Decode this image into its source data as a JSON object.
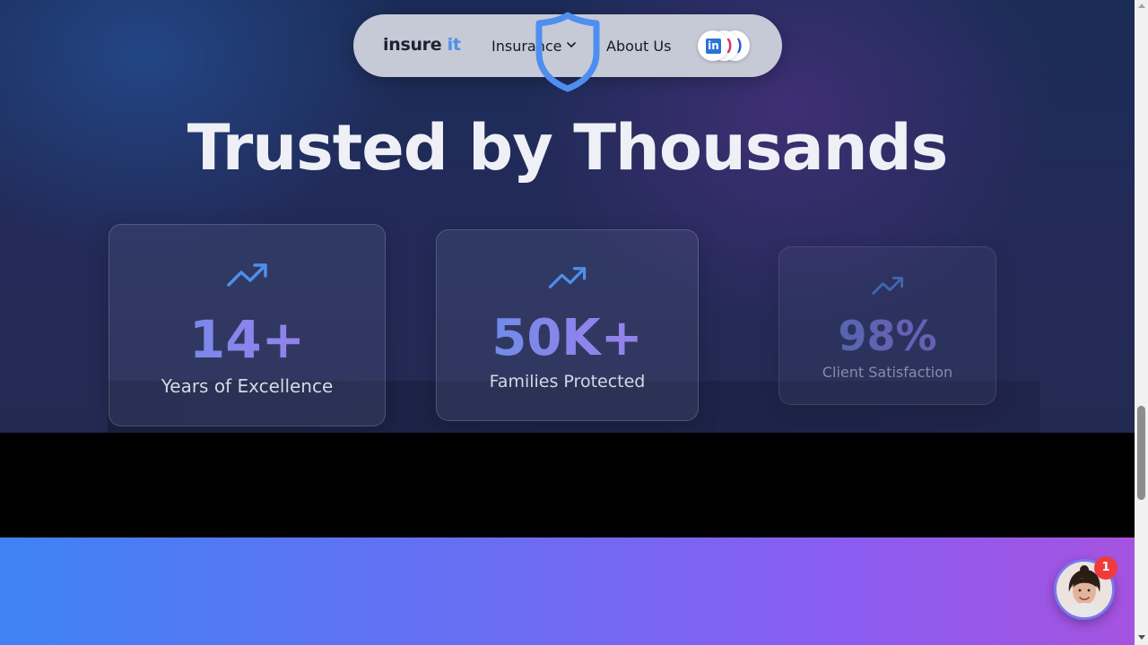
{
  "nav": {
    "logo_main": "insure",
    "logo_accent": "it",
    "links": [
      "Insurance",
      "About Us"
    ],
    "socials": [
      "linkedin-icon",
      "instagram-icon",
      "messenger-icon"
    ],
    "social_linkedin_glyph": "in"
  },
  "hero": {
    "headline": "Trusted by Thousands",
    "stats": [
      {
        "icon": "trending-up-icon",
        "value": "14+",
        "label": "Years of Excellence"
      },
      {
        "icon": "trending-up-icon",
        "value": "50K+",
        "label": "Families Protected"
      },
      {
        "icon": "trending-up-icon",
        "value": "98%",
        "label": "Client Satisfaction"
      }
    ]
  },
  "chat": {
    "notification_count": "1"
  },
  "colors": {
    "accent_blue": "#4f8fe8",
    "accent_purple": "#8d84ec",
    "badge_red": "#ef3b3b"
  }
}
